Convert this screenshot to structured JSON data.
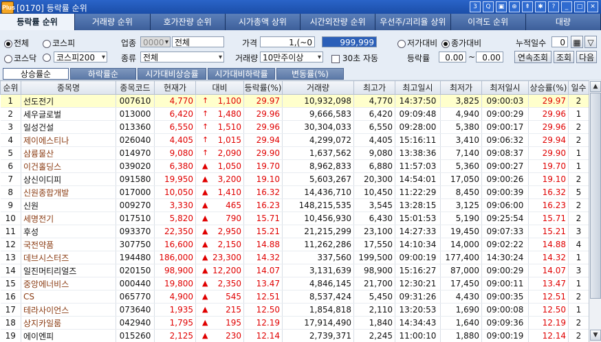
{
  "window": {
    "title": "[0170] 등락률 순위",
    "logo": "Plus",
    "icons": [
      "help-3-icon",
      "search-icon",
      "copy-icon",
      "zoom-icon",
      "pin-icon",
      "settings-icon",
      "question-icon",
      "minimize-icon",
      "maximize-icon",
      "close-icon"
    ],
    "icon_glyphs": [
      "3",
      "Q",
      "▣",
      "⊕",
      "⇞",
      "✱",
      "?",
      "_",
      "□",
      "✕"
    ]
  },
  "tabs": [
    "등락률 순위",
    "거래량 순위",
    "호가잔량 순위",
    "시가총액 상위",
    "시간외잔량 순위",
    "우선주/괴리율 상위",
    "이격도 순위",
    "대량"
  ],
  "filters": {
    "market_all": "전체",
    "market_kospi": "코스피",
    "market_kosdaq": "코스닥",
    "kospi200": "코스피200",
    "sector_label": "업종",
    "sector_code": "0000",
    "sector_name": "전체",
    "type_label": "종류",
    "type_value": "전체",
    "price_label": "가격",
    "price_from": "1,(~0",
    "price_to": "999,999",
    "volume_label": "거래량",
    "volume_value": "10만주이상",
    "realtime_label": "30초 자동",
    "vs_open": "저가대비",
    "vs_close": "종가대비",
    "days_label": "누적일수",
    "days_value": "0",
    "rate_label": "등락률",
    "rate_from": "0.00",
    "rate_sep": "~",
    "rate_to": "0.00",
    "btn_continuous": "연속조회",
    "btn_query": "조회",
    "btn_next": "다음"
  },
  "subtabs": [
    "상승률순",
    "하락률순",
    "시가대비상승률",
    "시가대비하락률",
    "변동률(%)"
  ],
  "columns": [
    "순위",
    "종목명",
    "종목코드",
    "현재가",
    "대비",
    "등락률(%)",
    "거래량",
    "최고가",
    "최고일시",
    "최저가",
    "최저일시",
    "상승률(%)",
    "일수"
  ],
  "rows": [
    [
      "1",
      "선도전기",
      "007610",
      "4,770",
      "↑",
      "1,100",
      "29.97",
      "10,932,098",
      "4,770",
      "14:37:50",
      "3,825",
      "09:00:03",
      "29.97",
      "2"
    ],
    [
      "2",
      "세우글로벌",
      "013000",
      "6,420",
      "↑",
      "1,480",
      "29.96",
      "9,666,583",
      "6,420",
      "09:09:48",
      "4,940",
      "09:00:29",
      "29.96",
      "1"
    ],
    [
      "3",
      "일성건설",
      "013360",
      "6,550",
      "↑",
      "1,510",
      "29.96",
      "30,304,033",
      "6,550",
      "09:28:00",
      "5,380",
      "09:00:17",
      "29.96",
      "2"
    ],
    [
      "4",
      "제이에스티나",
      "026040",
      "4,405",
      "↑",
      "1,015",
      "29.94",
      "4,299,072",
      "4,405",
      "15:16:11",
      "3,410",
      "09:06:32",
      "29.94",
      "2"
    ],
    [
      "5",
      "삼륭물산",
      "014970",
      "9,080",
      "↑",
      "2,090",
      "29.90",
      "1,637,562",
      "9,080",
      "13:38:36",
      "7,140",
      "09:08:37",
      "29.90",
      "1"
    ],
    [
      "6",
      "이건홀딩스",
      "039020",
      "6,380",
      "▲",
      "1,050",
      "19.70",
      "8,962,833",
      "6,880",
      "11:57:03",
      "5,360",
      "09:00:27",
      "19.70",
      "1"
    ],
    [
      "7",
      "상신이디피",
      "091580",
      "19,950",
      "▲",
      "3,200",
      "19.10",
      "5,603,267",
      "20,300",
      "14:54:01",
      "17,050",
      "09:00:26",
      "19.10",
      "2"
    ],
    [
      "8",
      "신원종합개발",
      "017000",
      "10,050",
      "▲",
      "1,410",
      "16.32",
      "14,436,710",
      "10,450",
      "11:22:29",
      "8,450",
      "09:00:39",
      "16.32",
      "5"
    ],
    [
      "9",
      "신원",
      "009270",
      "3,330",
      "▲",
      "465",
      "16.23",
      "148,215,535",
      "3,545",
      "13:28:15",
      "3,125",
      "09:06:00",
      "16.23",
      "2"
    ],
    [
      "10",
      "세명전기",
      "017510",
      "5,820",
      "▲",
      "790",
      "15.71",
      "10,456,930",
      "6,430",
      "15:01:53",
      "5,190",
      "09:25:54",
      "15.71",
      "2"
    ],
    [
      "11",
      "후성",
      "093370",
      "22,350",
      "▲",
      "2,950",
      "15.21",
      "21,215,299",
      "23,100",
      "14:27:33",
      "19,450",
      "09:07:33",
      "15.21",
      "3"
    ],
    [
      "12",
      "국전약품",
      "307750",
      "16,600",
      "▲",
      "2,150",
      "14.88",
      "11,262,286",
      "17,550",
      "14:10:34",
      "14,000",
      "09:02:22",
      "14.88",
      "4"
    ],
    [
      "13",
      "데브시스터즈",
      "194480",
      "186,000",
      "▲",
      "23,300",
      "14.32",
      "337,560",
      "199,500",
      "09:00:19",
      "177,400",
      "14:30:24",
      "14.32",
      "1"
    ],
    [
      "14",
      "일진머티리얼즈",
      "020150",
      "98,900",
      "▲",
      "12,200",
      "14.07",
      "3,131,639",
      "98,900",
      "15:16:27",
      "87,000",
      "09:00:29",
      "14.07",
      "3"
    ],
    [
      "15",
      "중앙에너비스",
      "000440",
      "19,800",
      "▲",
      "2,350",
      "13.47",
      "4,846,145",
      "21,700",
      "12:30:21",
      "17,450",
      "09:00:11",
      "13.47",
      "1"
    ],
    [
      "16",
      "CS",
      "065770",
      "4,900",
      "▲",
      "545",
      "12.51",
      "8,537,424",
      "5,450",
      "09:31:26",
      "4,430",
      "09:00:35",
      "12.51",
      "2"
    ],
    [
      "17",
      "테라사이언스",
      "073640",
      "1,935",
      "▲",
      "215",
      "12.50",
      "1,854,818",
      "2,110",
      "13:20:53",
      "1,690",
      "09:00:08",
      "12.50",
      "1"
    ],
    [
      "18",
      "상지카일룸",
      "042940",
      "1,795",
      "▲",
      "195",
      "12.19",
      "17,914,490",
      "1,840",
      "14:34:43",
      "1,640",
      "09:09:36",
      "12.19",
      "2"
    ],
    [
      "19",
      "에이엔피",
      "015260",
      "2,125",
      "▲",
      "230",
      "12.14",
      "2,739,371",
      "2,245",
      "11:00:10",
      "1,880",
      "09:00:19",
      "12.14",
      "2"
    ],
    [
      "20",
      "네오펙트",
      "290660",
      "3,560",
      "▲",
      "385",
      "12.13",
      "6,176,600",
      "4,060",
      "10:17:27",
      "3,180",
      "09:37:13",
      "12.13",
      "1"
    ]
  ],
  "brown_rows": [
    4,
    5,
    6,
    8,
    10,
    12,
    13,
    15,
    16,
    17,
    18,
    20
  ],
  "colors": {
    "up": "#e00000",
    "brown": "#8a3b12",
    "selected": "#ffffcc",
    "header": "#1f3f7a"
  }
}
